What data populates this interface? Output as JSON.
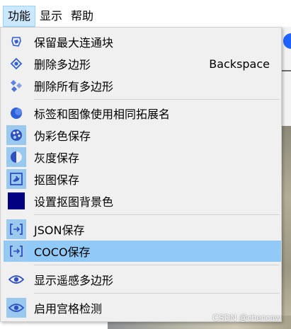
{
  "menubar": {
    "items": [
      {
        "label": "功能",
        "active": true
      },
      {
        "label": "显示",
        "active": false
      },
      {
        "label": "帮助",
        "active": false
      }
    ]
  },
  "menu": {
    "items": [
      {
        "label": "保留最大连通块",
        "icon": "keep-largest-component-icon"
      },
      {
        "label": "删除多边形",
        "icon": "delete-polygon-icon",
        "shortcut": "Backspace"
      },
      {
        "label": "删除所有多边形",
        "icon": "delete-all-polygons-icon"
      },
      {
        "label": "标签和图像使用相同拓展名",
        "icon": "same-extension-icon",
        "checked": false
      },
      {
        "label": "伪彩色保存",
        "icon": "pseudo-color-save-icon",
        "checked": true
      },
      {
        "label": "灰度保存",
        "icon": "grayscale-save-icon",
        "checked": true
      },
      {
        "label": "抠图保存",
        "icon": "matting-save-icon",
        "checked": true
      },
      {
        "label": "设置抠图背景色",
        "icon": "background-color-swatch-icon"
      },
      {
        "label": "JSON保存",
        "icon": "json-save-icon",
        "checked": true
      },
      {
        "label": "COCO保存",
        "icon": "coco-save-icon",
        "checked": true,
        "highlighted": true
      },
      {
        "label": "显示遥感多边形",
        "icon": "eye-icon",
        "checked": false
      },
      {
        "label": "启用宫格检测",
        "icon": "eye-icon",
        "checked": true
      }
    ]
  },
  "colors": {
    "accent": "#1e63ff",
    "highlight": "#91c9f7",
    "checked_bg": "#99c9ef",
    "swatch": "#000080",
    "icon_blue": "#2f5fd8"
  },
  "watermark": "CSDN @chencaw"
}
